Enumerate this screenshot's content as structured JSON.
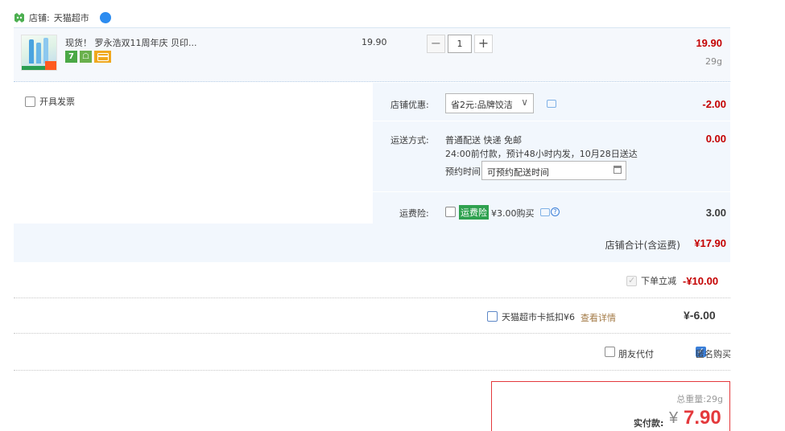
{
  "shop": {
    "label": "店铺:",
    "name": "天猫超市"
  },
  "item": {
    "title": "现货！ 罗永浩双11周年庆 贝印...",
    "unit_price": "19.90",
    "quantity": "1",
    "minus": "−",
    "plus": "+",
    "subtotal": "19.90",
    "weight": "29g",
    "badges": {
      "seven": "7",
      "plus": "☖"
    }
  },
  "invoice": {
    "label": "开具发票"
  },
  "coupon": {
    "label": "店铺优惠:",
    "selected": "省2元:品牌饺洁",
    "amount": "-2.00"
  },
  "shipping": {
    "label": "运送方式:",
    "method": "普通配送 快递 免邮",
    "detail": "24:00前付款，预计48小时内发，10月28日送达",
    "appoint_label": "预约时间",
    "appoint_value": "可预约配送时间",
    "amount": "0.00"
  },
  "insurance": {
    "label": "运费险:",
    "tag": "运费险",
    "price": "¥3.00购买",
    "amount": "3.00",
    "help": "?"
  },
  "shop_total": {
    "label": "店铺合计(含运费)",
    "amount": "¥17.90"
  },
  "instant_discount": {
    "label": "下单立减",
    "amount": "-¥10.00"
  },
  "card_deduct": {
    "label": "天猫超市卡抵扣¥6",
    "link": "查看详情",
    "amount": "¥-6.00"
  },
  "options": {
    "friend_pay": "朋友代付",
    "anonymous": "匿名购买"
  },
  "payment": {
    "weight_label": "总重量:",
    "weight": "29g",
    "pay_label": "实付款:",
    "currency": "¥",
    "amount": "7.90"
  },
  "colors": {
    "price_red": "#c40000",
    "panel_blue": "#f2f7fd",
    "accent_blue": "#3b7fd8",
    "border_red": "#e4393c"
  }
}
